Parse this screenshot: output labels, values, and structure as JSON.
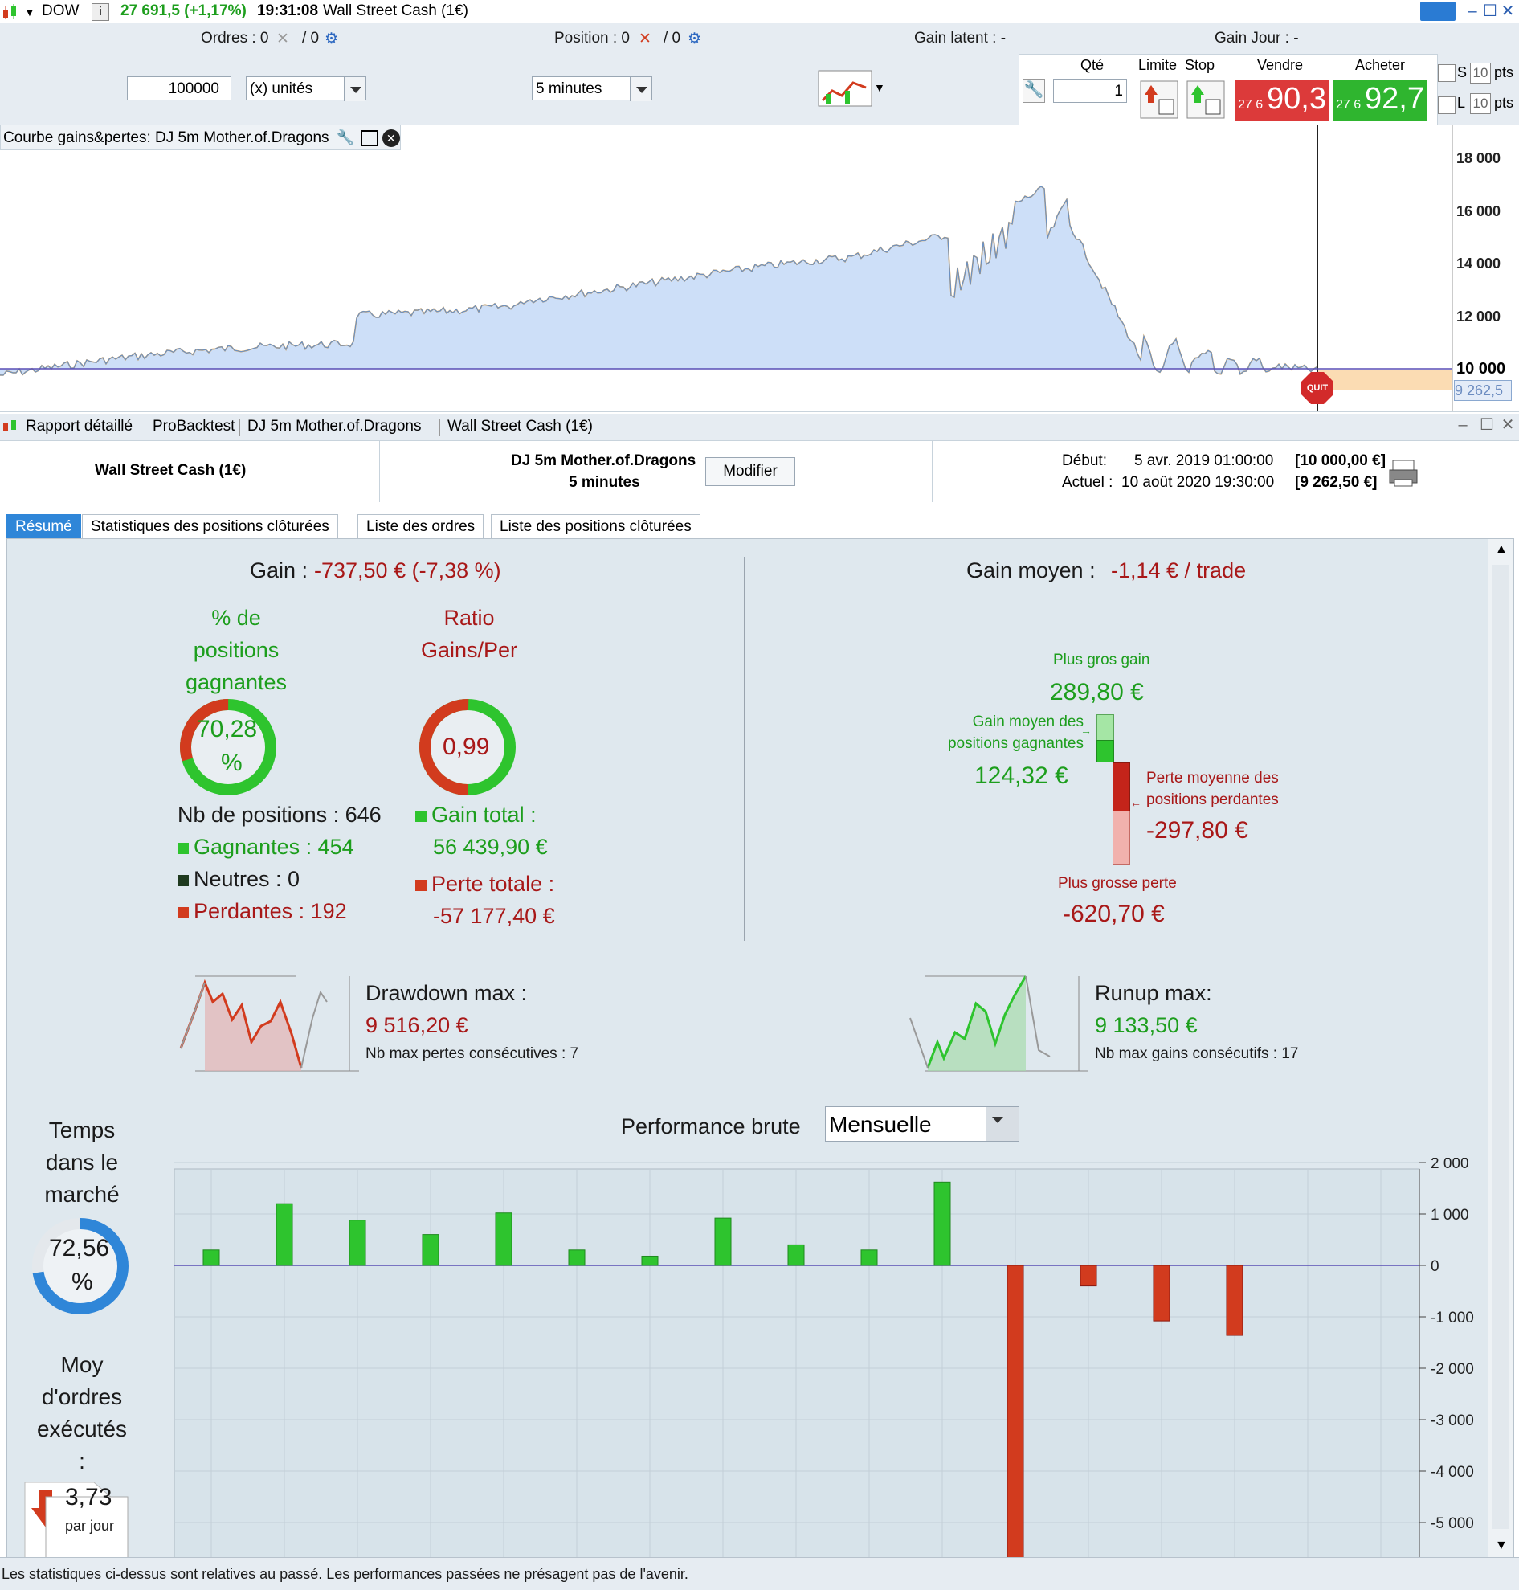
{
  "topbar": {
    "symbol": "DOW",
    "quote": "27 691,5 (+1,17%)",
    "time": "19:31:08",
    "instrument": "Wall Street Cash (1€)"
  },
  "orderbar": {
    "orders_label": "Ordres : 0",
    "orders_count": "/ 0",
    "position_label": "Position : 0",
    "position_count": "/ 0",
    "gain_latent": "Gain latent : -",
    "gain_jour": "Gain Jour : -"
  },
  "controls": {
    "amount": "100000",
    "unit": "(x) unités",
    "timeframe": "5 minutes"
  },
  "trade": {
    "qty_label": "Qté",
    "qty": "1",
    "limit_label": "Limite",
    "stop_label": "Stop",
    "sell_label": "Vendre",
    "buy_label": "Acheter",
    "sell_small": "27 6",
    "sell_big": "90,3",
    "buy_small": "27 6",
    "buy_big": "92,7",
    "s_label": "S",
    "l_label": "L",
    "s_pts": "10",
    "l_pts": "10",
    "pts_label": "pts"
  },
  "equity_chart": {
    "title": "Courbe gains&pertes: DJ 5m Mother.of.Dragons",
    "y_ticks": [
      "18 000",
      "16 000",
      "14 000",
      "12 000",
      "10 000"
    ],
    "current_value": "9 262,5",
    "quit_label": "QUIT",
    "colors": {
      "fill": "#cddff8",
      "line": "#5b8fd6",
      "flat": "#f0a030"
    }
  },
  "report": {
    "header": [
      "Rapport détaillé",
      "ProBacktest",
      "DJ 5m Mother.of.Dragons",
      "Wall Street Cash (1€)"
    ],
    "instrument": "Wall Street Cash (1€)",
    "strategy": "DJ 5m Mother.of.Dragons",
    "timeframe": "5 minutes",
    "modify_button": "Modifier",
    "debut_label": "Début:",
    "debut_value": "5 avr. 2019 01:00:00",
    "debut_capital": "[10 000,00 €]",
    "actuel_label": "Actuel :",
    "actuel_value": "10 août 2020 19:30:00",
    "actuel_capital": "[9 262,50 €]",
    "tabs": [
      "Résumé",
      "Statistiques des positions clôturées",
      "Liste des ordres",
      "Liste des positions clôturées"
    ]
  },
  "summary": {
    "gain_label": "Gain :",
    "gain_value": "-737,50 € (-7,38 %)",
    "pct_win_label": [
      "% de",
      "positions",
      "gagnantes"
    ],
    "pct_win_value": [
      "70,28",
      "%"
    ],
    "pct_win_fraction": 0.7028,
    "ratio_label": [
      "Ratio",
      "Gains/Per"
    ],
    "ratio_value": "0,99",
    "ratio_fraction": 0.497,
    "nb_positions": "Nb de positions : 646",
    "gagnantes": "Gagnantes : 454",
    "neutres": "Neutres : 0",
    "perdantes": "Perdantes : 192",
    "gain_total_label": "Gain total :",
    "gain_total_value": "56 439,90 €",
    "perte_totale_label": "Perte totale :",
    "perte_totale_value": "-57 177,40 €",
    "gain_moyen_label": "Gain moyen :",
    "gain_moyen_value": "-1,14 € / trade",
    "plus_gros_gain_label": "Plus gros gain",
    "plus_gros_gain_value": "289,80 €",
    "gain_moyen_gagnantes_label": [
      "Gain moyen des",
      "positions gagnantes"
    ],
    "gain_moyen_gagnantes_value": "124,32 €",
    "perte_moyenne_label": [
      "Perte moyenne des",
      "positions perdantes"
    ],
    "perte_moyenne_value": "-297,80 €",
    "plus_grosse_perte_label": "Plus grosse perte",
    "plus_grosse_perte_value": "-620,70 €",
    "drawdown_label": "Drawdown max :",
    "drawdown_value": "9 516,20 €",
    "drawdown_sub": "Nb max pertes consécutives : 7",
    "runup_label": "Runup max:",
    "runup_value": "9 133,50 €",
    "runup_sub": "Nb max gains consécutifs : 17",
    "temps_label": [
      "Temps",
      "dans le",
      "marché"
    ],
    "temps_value": [
      "72,56",
      "%"
    ],
    "temps_fraction": 0.7256,
    "moy_label": [
      "Moy",
      "d'ordres",
      "exécutés",
      ":"
    ],
    "moy_value": "3,73",
    "moy_unit": "par jour",
    "perf_label": "Performance brute",
    "perf_period": "Mensuelle"
  },
  "chart_data": {
    "type": "bar",
    "title": "Performance brute",
    "categories": [],
    "values": [
      300,
      1200,
      880,
      600,
      1020,
      300,
      180,
      920,
      400,
      300,
      1620,
      -5800,
      -400,
      -1080,
      -1360
    ],
    "y_ticks": [
      "2 000",
      "1 000",
      "0",
      "-1 000",
      "-2 000",
      "-3 000",
      "-4 000",
      "-5 000"
    ],
    "ylim": [
      -5600,
      2000
    ],
    "grid": true,
    "colors": {
      "positive": "#2ec42e",
      "negative": "#d23b1e"
    }
  },
  "footer": {
    "disclaimer": "Les statistiques ci-dessus sont relatives au passé. Les performances passées ne présagent pas de l'avenir."
  }
}
